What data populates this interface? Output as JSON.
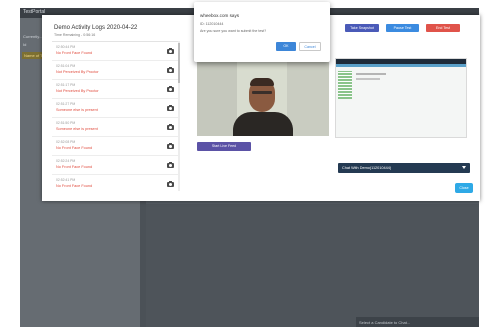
{
  "app": {
    "brand": "TestPortal"
  },
  "background": {
    "left_panel": {
      "lines": [
        "Currently...",
        "Id"
      ],
      "highlight_label": "Name of Test"
    },
    "chat_footer": "Select a Candidate to Chat..."
  },
  "modal": {
    "title": "Demo Activity Logs 2020-04-22",
    "subtitle": "Time Remaining - 0:56:16",
    "logs": [
      {
        "time": "02:50:44 PM",
        "message": "No Front Face Found"
      },
      {
        "time": "02:51:04 PM",
        "message": "Not Perceived By Proctor"
      },
      {
        "time": "02:51:17 PM",
        "message": "Not Perceived By Proctor"
      },
      {
        "time": "02:51:27 PM",
        "message": "Someone else is present"
      },
      {
        "time": "02:51:50 PM",
        "message": "Someone else is present"
      },
      {
        "time": "02:52:08 PM",
        "message": "No Front Face Found"
      },
      {
        "time": "02:52:24 PM",
        "message": "No Front Face Found"
      },
      {
        "time": "02:52:41 PM",
        "message": "No Front Face Found"
      }
    ],
    "buttons": {
      "snapshot": "Take Snapshot",
      "pause": "Pause Test",
      "end": "End Test",
      "live": "Start Live Feed",
      "close": "Close"
    },
    "chat_select": "Chat With Demo(112010444)"
  },
  "dialog": {
    "title": "wheebox.com says",
    "id_text": "ID: 112010444",
    "message": "Are you sure you want to submit the test?",
    "ok": "OK",
    "cancel": "Cancel"
  },
  "colors": {
    "snapshot": "#4a5ab8",
    "pause": "#3b8be0",
    "end": "#e0534a",
    "live": "#5b52a6",
    "close": "#2ea9e6",
    "log_message": "#e04a3c"
  }
}
